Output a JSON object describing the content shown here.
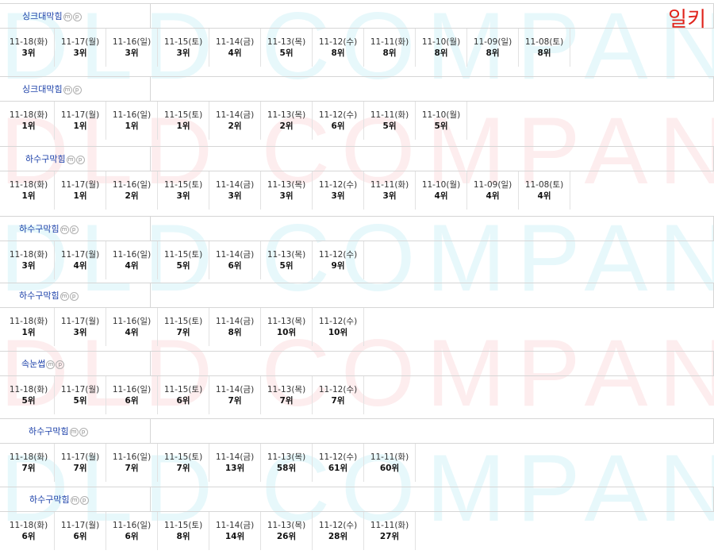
{
  "watermark": "DLD COMPANY",
  "corner_label": "일키",
  "badges": [
    "m",
    "p"
  ],
  "sections": [
    {
      "title": "싱크대막힘",
      "entries": [
        {
          "date": "11-18(화)",
          "rank": "3위"
        },
        {
          "date": "11-17(월)",
          "rank": "3위"
        },
        {
          "date": "11-16(일)",
          "rank": "3위"
        },
        {
          "date": "11-15(토)",
          "rank": "3위"
        },
        {
          "date": "11-14(금)",
          "rank": "4위"
        },
        {
          "date": "11-13(목)",
          "rank": "5위"
        },
        {
          "date": "11-12(수)",
          "rank": "8위"
        },
        {
          "date": "11-11(화)",
          "rank": "8위"
        },
        {
          "date": "11-10(월)",
          "rank": "8위"
        },
        {
          "date": "11-09(일)",
          "rank": "8위"
        },
        {
          "date": "11-08(토)",
          "rank": "8위"
        }
      ]
    },
    {
      "title": "싱크대막힘",
      "entries": [
        {
          "date": "11-18(화)",
          "rank": "1위"
        },
        {
          "date": "11-17(월)",
          "rank": "1위"
        },
        {
          "date": "11-16(일)",
          "rank": "1위"
        },
        {
          "date": "11-15(토)",
          "rank": "1위"
        },
        {
          "date": "11-14(금)",
          "rank": "2위"
        },
        {
          "date": "11-13(목)",
          "rank": "2위"
        },
        {
          "date": "11-12(수)",
          "rank": "6위"
        },
        {
          "date": "11-11(화)",
          "rank": "5위"
        },
        {
          "date": "11-10(월)",
          "rank": "5위"
        }
      ]
    },
    {
      "title": "하수구막힘",
      "entries": [
        {
          "date": "11-18(화)",
          "rank": "1위"
        },
        {
          "date": "11-17(월)",
          "rank": "1위"
        },
        {
          "date": "11-16(일)",
          "rank": "2위"
        },
        {
          "date": "11-15(토)",
          "rank": "3위"
        },
        {
          "date": "11-14(금)",
          "rank": "3위"
        },
        {
          "date": "11-13(목)",
          "rank": "3위"
        },
        {
          "date": "11-12(수)",
          "rank": "3위"
        },
        {
          "date": "11-11(화)",
          "rank": "3위"
        },
        {
          "date": "11-10(월)",
          "rank": "4위"
        },
        {
          "date": "11-09(일)",
          "rank": "4위"
        },
        {
          "date": "11-08(토)",
          "rank": "4위"
        }
      ]
    },
    {
      "title": "하수구막힘",
      "entries": [
        {
          "date": "11-18(화)",
          "rank": "3위"
        },
        {
          "date": "11-17(월)",
          "rank": "4위"
        },
        {
          "date": "11-16(일)",
          "rank": "4위"
        },
        {
          "date": "11-15(토)",
          "rank": "5위"
        },
        {
          "date": "11-14(금)",
          "rank": "6위"
        },
        {
          "date": "11-13(목)",
          "rank": "5위"
        },
        {
          "date": "11-12(수)",
          "rank": "9위"
        }
      ]
    },
    {
      "title": "하수구막힘",
      "entries": [
        {
          "date": "11-18(화)",
          "rank": "1위"
        },
        {
          "date": "11-17(월)",
          "rank": "3위"
        },
        {
          "date": "11-16(일)",
          "rank": "4위"
        },
        {
          "date": "11-15(토)",
          "rank": "7위"
        },
        {
          "date": "11-14(금)",
          "rank": "8위"
        },
        {
          "date": "11-13(목)",
          "rank": "10위"
        },
        {
          "date": "11-12(수)",
          "rank": "10위"
        }
      ]
    },
    {
      "title": "속눈썹",
      "entries": [
        {
          "date": "11-18(화)",
          "rank": "5위"
        },
        {
          "date": "11-17(월)",
          "rank": "5위"
        },
        {
          "date": "11-16(일)",
          "rank": "6위"
        },
        {
          "date": "11-15(토)",
          "rank": "6위"
        },
        {
          "date": "11-14(금)",
          "rank": "7위"
        },
        {
          "date": "11-13(목)",
          "rank": "7위"
        },
        {
          "date": "11-12(수)",
          "rank": "7위"
        }
      ]
    },
    {
      "title": "하수구막힘",
      "entries": [
        {
          "date": "11-18(화)",
          "rank": "7위"
        },
        {
          "date": "11-17(월)",
          "rank": "7위"
        },
        {
          "date": "11-16(일)",
          "rank": "7위"
        },
        {
          "date": "11-15(토)",
          "rank": "7위"
        },
        {
          "date": "11-14(금)",
          "rank": "13위"
        },
        {
          "date": "11-13(목)",
          "rank": "58위"
        },
        {
          "date": "11-12(수)",
          "rank": "61위"
        },
        {
          "date": "11-11(화)",
          "rank": "60위"
        }
      ]
    },
    {
      "title": "하수구막힘",
      "entries": [
        {
          "date": "11-18(화)",
          "rank": "6위"
        },
        {
          "date": "11-17(월)",
          "rank": "6위"
        },
        {
          "date": "11-16(일)",
          "rank": "6위"
        },
        {
          "date": "11-15(토)",
          "rank": "8위"
        },
        {
          "date": "11-14(금)",
          "rank": "14위"
        },
        {
          "date": "11-13(목)",
          "rank": "26위"
        },
        {
          "date": "11-12(수)",
          "rank": "28위"
        },
        {
          "date": "11-11(화)",
          "rank": "27위"
        }
      ]
    }
  ]
}
